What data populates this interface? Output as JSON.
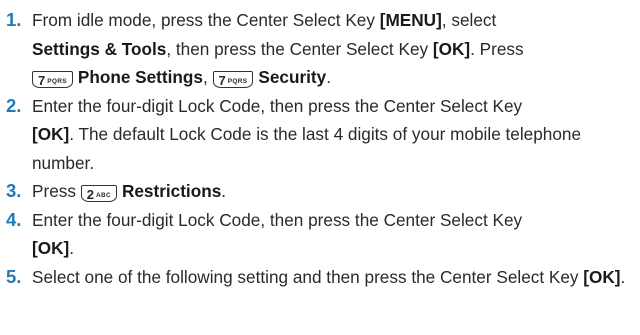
{
  "steps": [
    {
      "num": "1.",
      "t1": "From idle mode, press the Center Select Key ",
      "b1": "[MENU]",
      "t2": ", select ",
      "b2": "Settings & Tools",
      "t3": ", then press the Center Select Key ",
      "b3": "[OK]",
      "t4": ". Press ",
      "key1": {
        "digit": "7",
        "letters": "PQRS",
        "icon": "key-7-pqrs"
      },
      "b4": "Phone Settings",
      "t5": ", ",
      "key2": {
        "digit": "7",
        "letters": "PQRS",
        "icon": "key-7-pqrs"
      },
      "b5": "Security",
      "t6": "."
    },
    {
      "num": "2.",
      "t1": "Enter the four-digit Lock Code, then press the Center Select Key ",
      "b1": "[OK]",
      "t2": ". The default Lock Code is the last 4 digits of your mobile telephone number."
    },
    {
      "num": "3.",
      "t1": "Press ",
      "key1": {
        "digit": "2",
        "letters": "ABC",
        "icon": "key-2-abc"
      },
      "b1": "Restrictions",
      "t2": "."
    },
    {
      "num": "4.",
      "t1": "Enter the four-digit Lock Code, then press the Center Select Key ",
      "b1": "[OK]",
      "t2": "."
    },
    {
      "num": "5.",
      "t1": "Select one of the following setting and then press the Center Select Key ",
      "b1": "[OK]",
      "t2": "."
    }
  ],
  "colors": {
    "step_number": "#1f7bb8",
    "text": "#2a2a2a"
  }
}
